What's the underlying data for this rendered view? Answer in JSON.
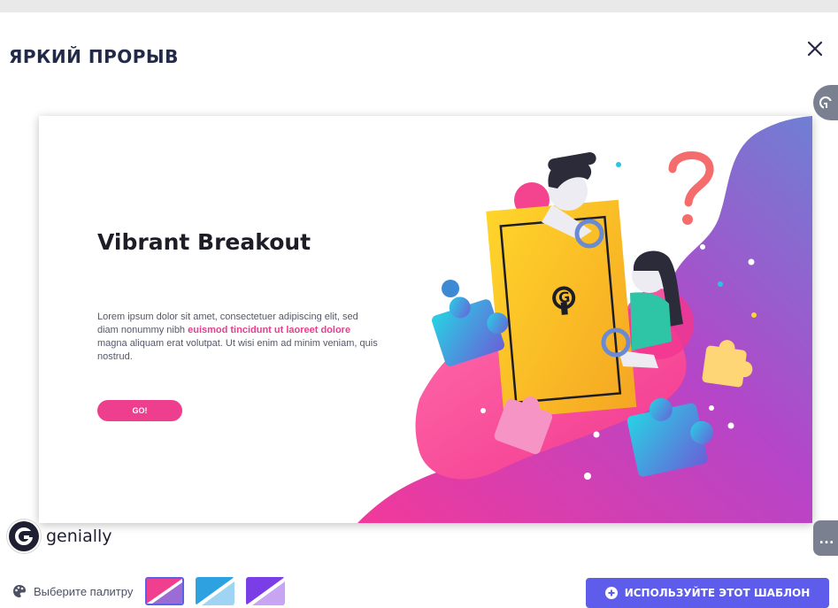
{
  "modal": {
    "title": "ЯРКИЙ ПРОРЫВ",
    "close_icon": "close-icon"
  },
  "slide": {
    "title": "Vibrant Breakout",
    "body_before": "Lorem ipsum dolor sit amet, consectetuer adipiscing elit, sed diam nonummy nibh ",
    "body_highlight": "euismod tincidunt ut laoreet dolore",
    "body_after": " magna aliquam erat volutpat. Ut wisi enim ad minim veniam, quis nostrud.",
    "button_label": "GO!",
    "logo_letter": "G"
  },
  "brand": {
    "name": "genially"
  },
  "palette": {
    "label": "Выберите палитру",
    "icon": "palette-icon",
    "swatches": [
      {
        "primary": "#ef3f8e",
        "secondary": "#9b6bd6",
        "selected": true
      },
      {
        "primary": "#2ea1e0",
        "secondary": "#9fd5f2",
        "selected": false
      },
      {
        "primary": "#7a3de6",
        "secondary": "#c7a5f2",
        "selected": false
      }
    ]
  },
  "actions": {
    "use_template_label": "ИСПОЛЬЗУЙТЕ ЭТОТ ШАБЛОН",
    "more_label": "…"
  },
  "colors": {
    "accent": "#5d5ceb",
    "pink": "#ee3f8f",
    "title": "#232a48"
  }
}
